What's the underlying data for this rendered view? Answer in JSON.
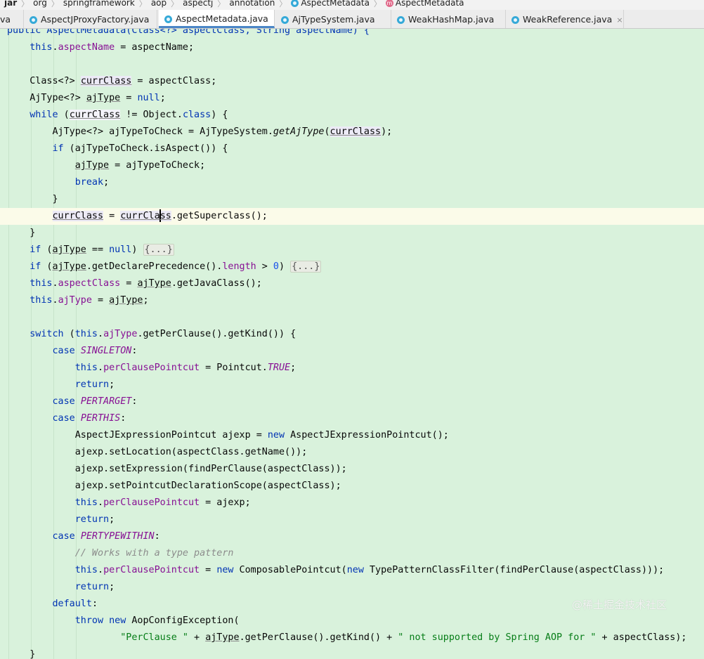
{
  "breadcrumb": [
    {
      "label": "jar",
      "bold": true
    },
    {
      "label": "org"
    },
    {
      "label": "springframework"
    },
    {
      "label": "aop"
    },
    {
      "label": "aspectj"
    },
    {
      "label": "annotation"
    },
    {
      "label": "AspectMetadata",
      "icon": "class-icon"
    },
    {
      "label": "AspectMetadata",
      "icon": "method-icon"
    }
  ],
  "tabs": [
    {
      "label": "va",
      "active": false
    },
    {
      "label": "AspectJProxyFactory.java",
      "active": false
    },
    {
      "label": "AspectMetadata.java",
      "active": true
    },
    {
      "label": "AjTypeSystem.java",
      "active": false
    },
    {
      "label": "WeakHashMap.java",
      "active": false
    },
    {
      "label": "WeakReference.java",
      "active": false
    }
  ],
  "tab_close_glyph": "×",
  "method_icon_letter": "m",
  "code": {
    "l0": "public AspectMetadata(Class<?> aspectClass, String aspectName) {",
    "l1": [
      "this",
      ".",
      "aspectName",
      " = aspectName;"
    ],
    "l3": [
      "Class<?> ",
      "currClass",
      " = aspectClass;"
    ],
    "l4": [
      "AjType<?> ",
      "ajType",
      " = ",
      "null",
      ";"
    ],
    "l5": [
      "while",
      " (",
      "currClass",
      " != Object.",
      "class",
      ") {"
    ],
    "l6": [
      "AjType<?> ajTypeToCheck = AjTypeSystem.",
      "getAjType",
      "(",
      "currClass",
      ");"
    ],
    "l7": [
      "if",
      " (ajTypeToCheck.isAspect()) {"
    ],
    "l8": [
      "ajType",
      " = ajTypeToCheck;"
    ],
    "l9": [
      "break",
      ";"
    ],
    "l10": "}",
    "l11": [
      "currClass",
      " = ",
      "currCla",
      "ss",
      ".getSuperclass();"
    ],
    "l12": "}",
    "l13": [
      "if",
      " (",
      "ajType",
      " == ",
      "null",
      ") ",
      "{...}"
    ],
    "l14": [
      "if",
      " (",
      "ajType",
      ".getDeclarePrecedence().",
      "length",
      " > ",
      "0",
      ") ",
      "{...}"
    ],
    "l15": [
      "this",
      ".",
      "aspectClass",
      " = ",
      "ajType",
      ".getJavaClass();"
    ],
    "l16": [
      "this",
      ".",
      "ajType",
      " = ",
      "ajType",
      ";"
    ],
    "l18": [
      "switch",
      " (",
      "this",
      ".",
      "ajType",
      ".getPerClause().getKind()) {"
    ],
    "l19": [
      "case",
      " ",
      "SINGLETON",
      ":"
    ],
    "l20": [
      "this",
      ".",
      "perClausePointcut",
      " = Pointcut.",
      "TRUE",
      ";"
    ],
    "l21": [
      "return",
      ";"
    ],
    "l22": [
      "case",
      " ",
      "PERTARGET",
      ":"
    ],
    "l23": [
      "case",
      " ",
      "PERTHIS",
      ":"
    ],
    "l24": [
      "AspectJExpressionPointcut ajexp = ",
      "new",
      " AspectJExpressionPointcut();"
    ],
    "l25": "ajexp.setLocation(aspectClass.getName());",
    "l26": "ajexp.setExpression(findPerClause(aspectClass));",
    "l27": "ajexp.setPointcutDeclarationScope(aspectClass);",
    "l28": [
      "this",
      ".",
      "perClausePointcut",
      " = ajexp;"
    ],
    "l29": [
      "return",
      ";"
    ],
    "l30": [
      "case",
      " ",
      "PERTYPEWITHIN",
      ":"
    ],
    "l31": "// Works with a type pattern",
    "l32": [
      "this",
      ".",
      "perClausePointcut",
      " = ",
      "new",
      " ComposablePointcut(",
      "new",
      " TypePatternClassFilter(findPerClause(aspectClass)));"
    ],
    "l33": [
      "return",
      ";"
    ],
    "l34": [
      "default",
      ":"
    ],
    "l35": [
      "throw",
      " ",
      "new",
      " AopConfigException("
    ],
    "l36": [
      "\"PerClause \"",
      " + ",
      "ajType",
      ".getPerClause().getKind() + ",
      "\" not supported by Spring AOP for \"",
      " + aspectClass);"
    ],
    "l37": "}"
  },
  "watermark": "@稀土掘金技术社区"
}
